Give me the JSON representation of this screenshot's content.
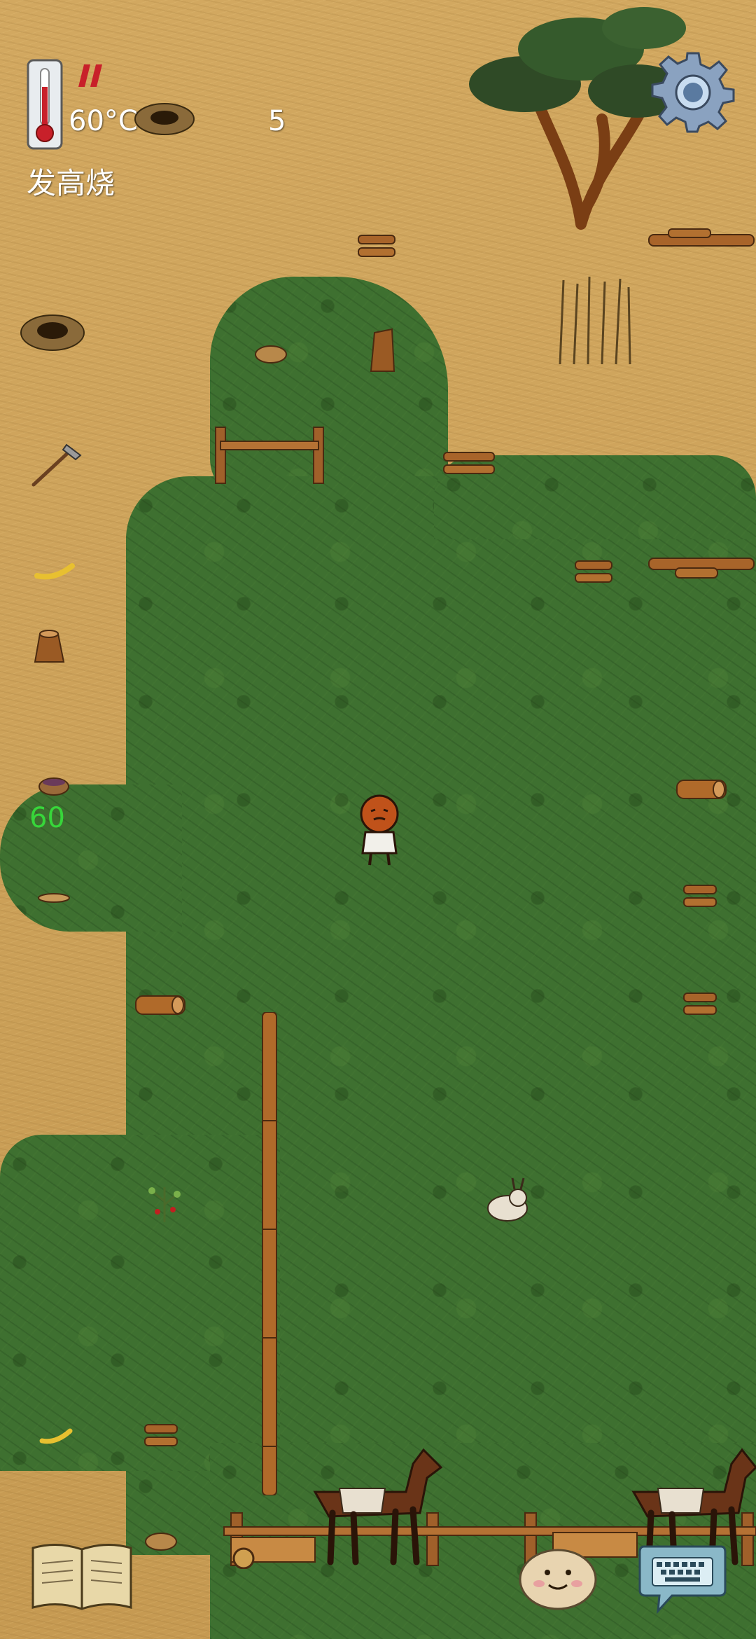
{
  "hud": {
    "temperature": "60°C",
    "counter": "5",
    "status": "发高烧",
    "floating_number": "60"
  },
  "icons": {
    "thermometer": "thermometer-icon",
    "heat_warning": "heat-warning-icon",
    "settings": "gear-icon",
    "journal": "book-icon",
    "emote": "face-icon",
    "chat": "keyboard-icon"
  },
  "colors": {
    "grass": "#3e7030",
    "dry_ground": "#c9a15a",
    "warning_red": "#c8202a",
    "floating_number": "#37d63a",
    "wood": "#b06a2a"
  }
}
